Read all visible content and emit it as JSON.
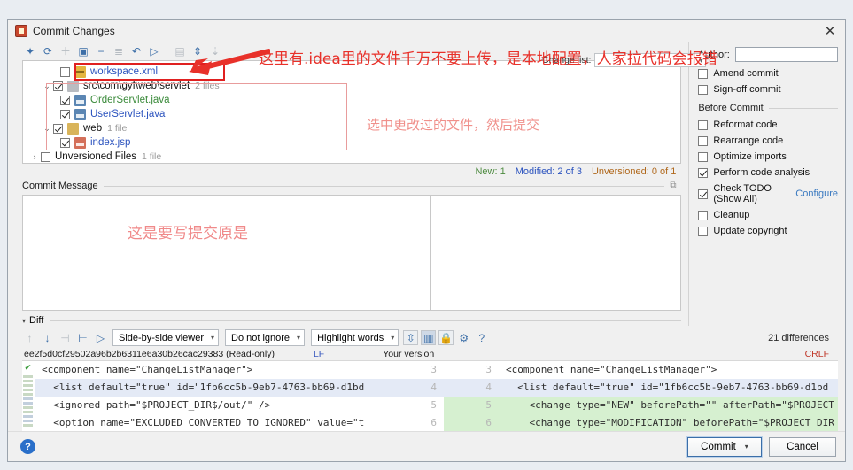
{
  "window": {
    "title": "Commit Changes",
    "close_label": "✕"
  },
  "toolbar": {
    "icons": [
      "magic-wand-icon",
      "refresh-icon",
      "plus-icon",
      "new-changelist-icon",
      "minus-icon",
      "group-by-icon",
      "revert-icon",
      "show-diff-icon",
      "preview-icon",
      "expand-all-icon",
      "collapse-all-icon"
    ]
  },
  "file_tree": {
    "rows": [
      {
        "indent": 2,
        "twisty": "",
        "checked": false,
        "icon": "xml-file-icon",
        "label": "workspace.xml",
        "color": "blue",
        "count": ""
      },
      {
        "indent": 1,
        "twisty": "⌄",
        "checked": true,
        "icon": "folder-icon",
        "label": "src\\com\\gyf\\web\\servlet",
        "color": "dark",
        "count": "2 files"
      },
      {
        "indent": 2,
        "twisty": "",
        "checked": true,
        "icon": "java-file-icon",
        "label": "OrderServlet.java",
        "color": "green",
        "count": ""
      },
      {
        "indent": 2,
        "twisty": "",
        "checked": true,
        "icon": "java-file-icon",
        "label": "UserServlet.java",
        "color": "blue",
        "count": ""
      },
      {
        "indent": 1,
        "twisty": "⌄",
        "checked": true,
        "icon": "folder-yellow-icon",
        "label": "web",
        "color": "dark",
        "count": "1 file"
      },
      {
        "indent": 2,
        "twisty": "",
        "checked": true,
        "icon": "jsp-file-icon",
        "label": "index.jsp",
        "color": "blue",
        "count": ""
      },
      {
        "indent": 0,
        "twisty": "›",
        "checked": false,
        "icon": "",
        "label": "Unversioned Files",
        "color": "dark",
        "count": "1 file"
      }
    ]
  },
  "status": {
    "new": "New: 1",
    "modified": "Modified: 2 of 3",
    "unversioned": "Unversioned: 0 of 1"
  },
  "commit_message": {
    "label": "Commit Message",
    "value": "",
    "annotation": "这是要写提交原是"
  },
  "changelist": {
    "label": "Change list:",
    "value": ""
  },
  "right_panel": {
    "author_label": "Author:",
    "author_value": "",
    "amend_commit": {
      "label": "Amend commit",
      "checked": false
    },
    "signoff_commit": {
      "label": "Sign-off commit",
      "checked": false
    },
    "before_commit_label": "Before Commit",
    "options": [
      {
        "label": "Reformat code",
        "checked": false
      },
      {
        "label": "Rearrange code",
        "checked": false
      },
      {
        "label": "Optimize imports",
        "checked": false
      },
      {
        "label": "Perform code analysis",
        "checked": true
      },
      {
        "label": "Check TODO (Show All)",
        "checked": true,
        "link": "Configure"
      },
      {
        "label": "Cleanup",
        "checked": false
      },
      {
        "label": "Update copyright",
        "checked": false
      }
    ]
  },
  "diff": {
    "section_label": "Diff",
    "viewer_mode": "Side-by-side viewer",
    "ignore_mode": "Do not ignore",
    "highlight_mode": "Highlight words",
    "differences": "21 differences",
    "revision": "ee2f5d0cf29502a96b2b6311e6a30b26cac29383 (Read-only)",
    "left_line_ending": "LF",
    "right_title": "Your version",
    "right_line_ending": "CRLF",
    "left_lines": [
      {
        "num": "3",
        "text": "<component name=\"ChangeListManager\">",
        "hl": "none"
      },
      {
        "num": "4",
        "text": "  <list default=\"true\" id=\"1fb6cc5b-9eb7-4763-bb69-d1bd",
        "hl": "blue"
      },
      {
        "num": "5",
        "text": "  <ignored path=\"$PROJECT_DIR$/out/\" />",
        "hl": "none"
      },
      {
        "num": "6",
        "text": "  <option name=\"EXCLUDED_CONVERTED_TO_IGNORED\" value=\"t",
        "hl": "none"
      }
    ],
    "right_lines": [
      {
        "num": "3",
        "text": "<component name=\"ChangeListManager\">",
        "hl": "none"
      },
      {
        "num": "4",
        "text": "  <list default=\"true\" id=\"1fb6cc5b-9eb7-4763-bb69-d1bd",
        "hl": "blue"
      },
      {
        "num": "5",
        "text": "    <change type=\"NEW\" beforePath=\"\" afterPath=\"$PROJECT",
        "hl": "green"
      },
      {
        "num": "6",
        "text": "    <change type=\"MODIFICATION\" beforePath=\"$PROJECT_DIR",
        "hl": "green"
      }
    ]
  },
  "footer": {
    "help": "?",
    "commit": "Commit",
    "commit_caret": "▾",
    "cancel": "Cancel"
  },
  "annotations": {
    "top": "这里有.idea里的文件千万不要上传，是本地配置，人家拉代码会报错",
    "middle": "选中更改过的文件，然后提交"
  },
  "colors": {
    "annotation_red": "#e8312a",
    "link_blue": "#3a79c0",
    "new_green": "#4c8a3f",
    "modified_blue": "#2a52be",
    "unversioned_orange": "#b0681c"
  }
}
